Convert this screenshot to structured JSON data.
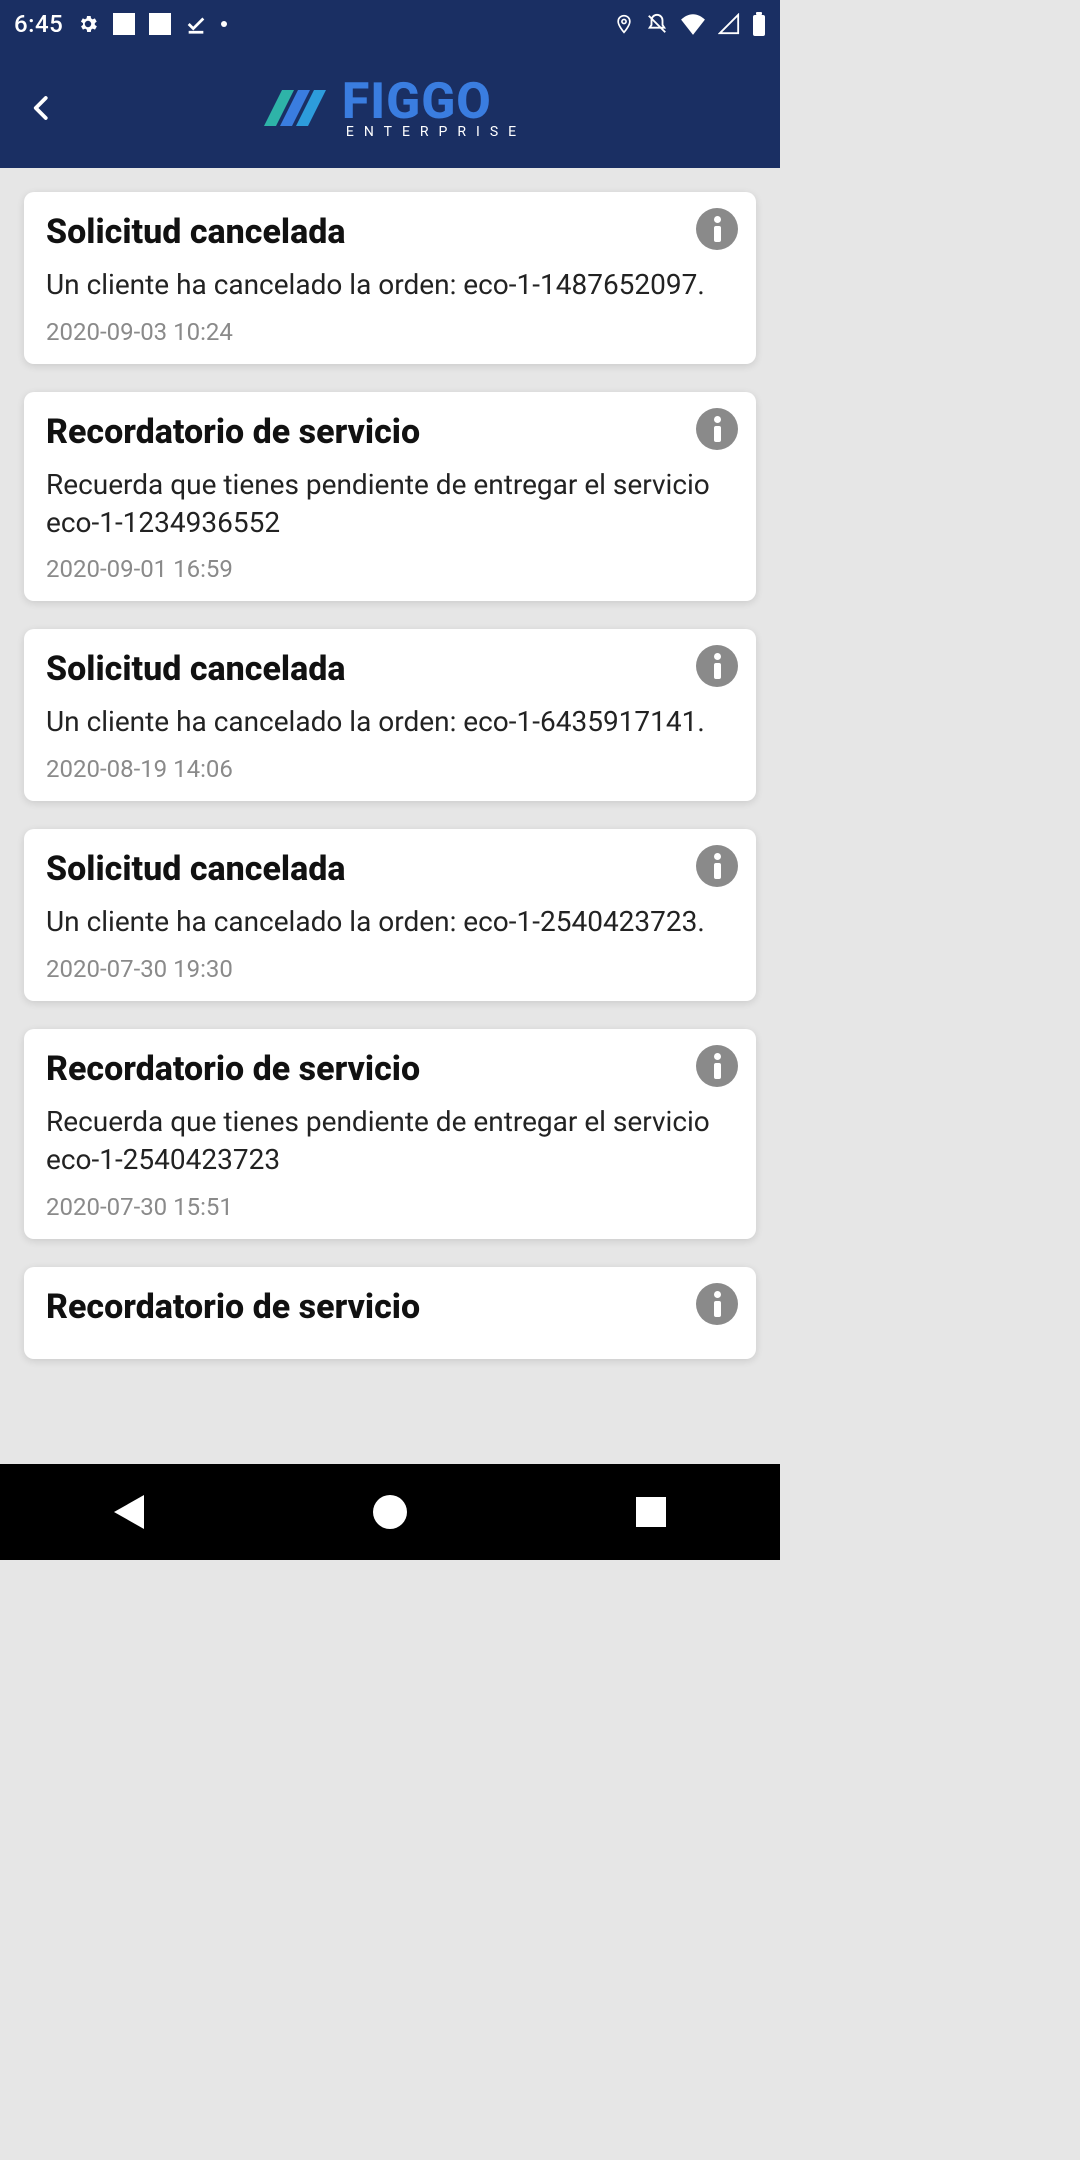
{
  "status": {
    "time": "6:45"
  },
  "header": {
    "brand_main": "FIGGO",
    "brand_sub": "ENTERPRISE"
  },
  "notifications": [
    {
      "title": "Solicitud cancelada",
      "body": "Un cliente ha cancelado la orden: eco-1-1487652097.",
      "timestamp": "2020-09-03 10:24"
    },
    {
      "title": "Recordatorio de servicio",
      "body": "Recuerda que tienes pendiente de entregar el servicio eco-1-1234936552",
      "timestamp": "2020-09-01 16:59"
    },
    {
      "title": "Solicitud cancelada",
      "body": "Un cliente ha cancelado la orden: eco-1-6435917141.",
      "timestamp": "2020-08-19 14:06"
    },
    {
      "title": "Solicitud cancelada",
      "body": "Un cliente ha cancelado la orden: eco-1-2540423723.",
      "timestamp": "2020-07-30 19:30"
    },
    {
      "title": "Recordatorio de servicio",
      "body": "Recuerda que tienes pendiente de entregar el servicio eco-1-2540423723",
      "timestamp": "2020-07-30 15:51"
    },
    {
      "title": "Recordatorio de servicio",
      "body": "",
      "timestamp": ""
    }
  ]
}
